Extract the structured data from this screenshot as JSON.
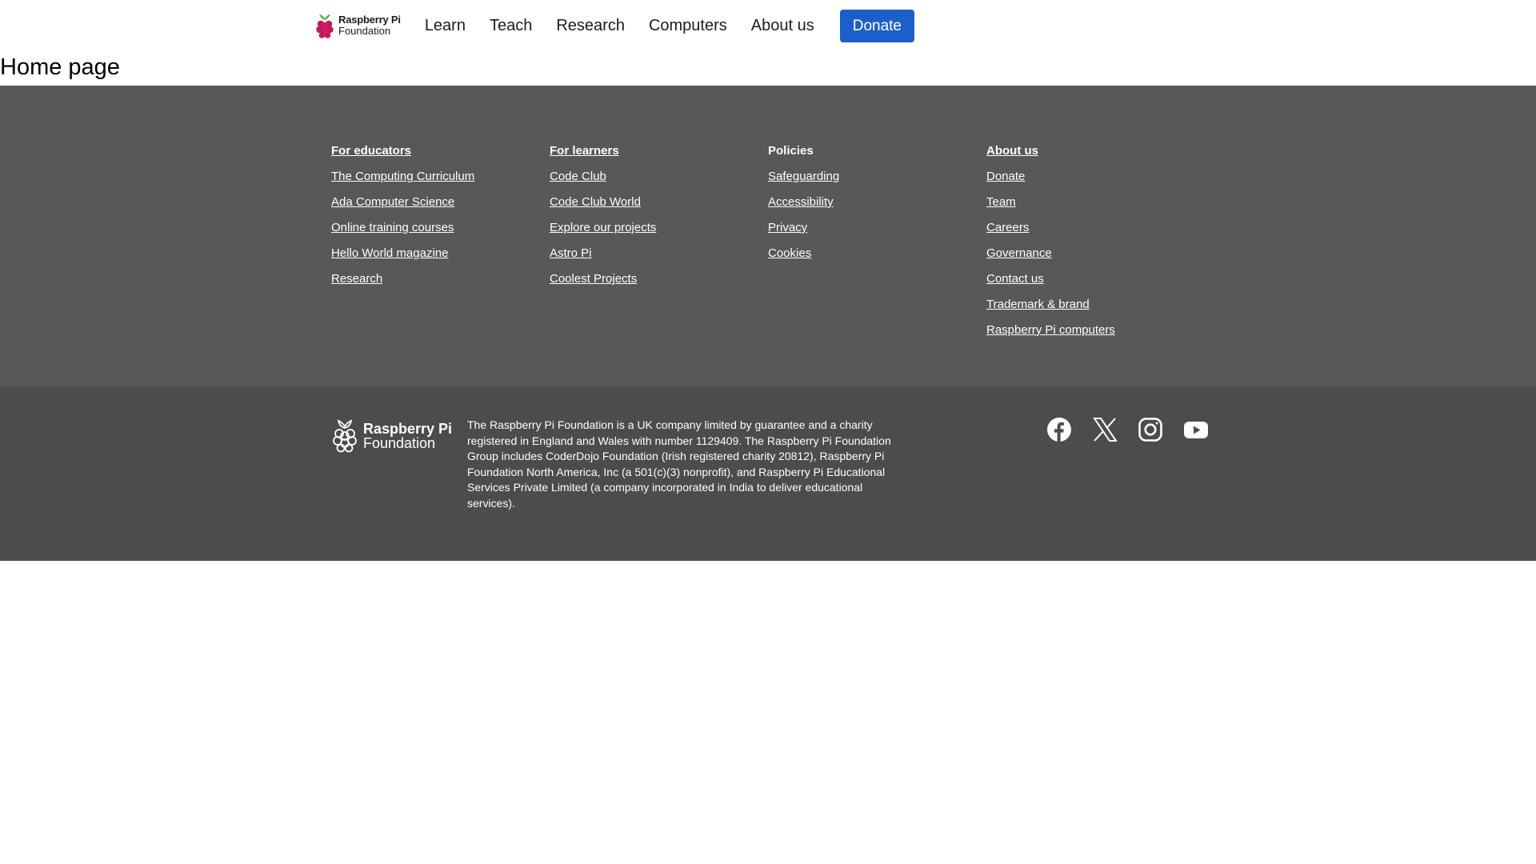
{
  "header": {
    "logo": {
      "line1": "Raspberry Pi",
      "line2": "Foundation",
      "icon": "raspberry-icon"
    },
    "nav": [
      "Learn",
      "Teach",
      "Research",
      "Computers",
      "About us"
    ],
    "donate_label": "Donate"
  },
  "page_title": "Home page",
  "footer": {
    "columns": [
      {
        "heading": "For educators",
        "heading_is_link": true,
        "links": [
          "The Computing Curriculum",
          "Ada Computer Science",
          "Online training courses",
          "Hello World magazine",
          "Research"
        ]
      },
      {
        "heading": "For learners",
        "heading_is_link": true,
        "links": [
          "Code Club",
          "Code Club World",
          "Explore our projects",
          "Astro Pi",
          "Coolest Projects"
        ]
      },
      {
        "heading": "Policies",
        "heading_is_link": false,
        "links": [
          "Safeguarding",
          "Accessibility",
          "Privacy",
          "Cookies"
        ]
      },
      {
        "heading": "About us",
        "heading_is_link": true,
        "links": [
          "Donate",
          "Team",
          "Careers",
          "Governance",
          "Contact us",
          "Trademark & brand",
          "Raspberry Pi computers"
        ]
      }
    ],
    "logo": {
      "line1": "Raspberry Pi",
      "line2": "Foundation"
    },
    "legal": "The Raspberry Pi Foundation is a UK company limited by guarantee and a charity registered in England and Wales with number 1129409. The Raspberry Pi Foundation Group includes CoderDojo Foundation (Irish registered charity 20812), Raspberry Pi Foundation North America, Inc (a 501(c)(3) nonprofit), and Raspberry Pi Educational Services Private Limited (a company incorporated in India to deliver educational services).",
    "social_icons": [
      "facebook-icon",
      "x-icon",
      "instagram-icon",
      "youtube-icon"
    ]
  },
  "colors": {
    "donate_button": "#1d5fc9",
    "footer_links_bg": "#58585a",
    "footer_bottom_bg": "#4c4c4e"
  }
}
